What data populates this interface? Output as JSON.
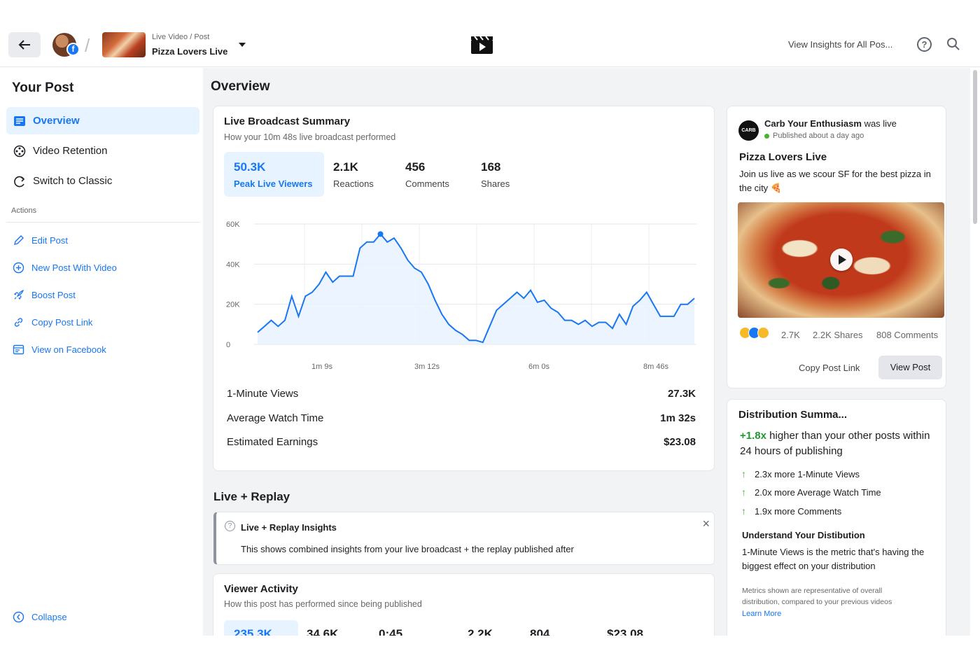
{
  "header": {
    "breadcrumb": "Live Video / Post",
    "post_title": "Pizza Lovers Live",
    "insights_link": "View Insights for All Pos...",
    "fb_badge": "f"
  },
  "sidebar": {
    "title": "Your Post",
    "nav": [
      "Overview",
      "Video Retention",
      "Switch to Classic"
    ],
    "actions_label": "Actions",
    "actions": [
      "Edit Post",
      "New Post With Video",
      "Boost Post",
      "Copy Post Link",
      "View on Facebook"
    ],
    "collapse": "Collapse"
  },
  "main": {
    "title": "Overview",
    "summary": {
      "title": "Live Broadcast Summary",
      "subtitle": "How your 10m 48s live broadcast performed",
      "metrics": [
        {
          "value": "50.3K",
          "label": "Peak Live Viewers"
        },
        {
          "value": "2.1K",
          "label": "Reactions"
        },
        {
          "value": "456",
          "label": "Comments"
        },
        {
          "value": "168",
          "label": "Shares"
        }
      ],
      "stats": [
        {
          "label": "1-Minute Views",
          "value": "27.3K"
        },
        {
          "label": "Average Watch Time",
          "value": "1m 32s"
        },
        {
          "label": "Estimated Earnings",
          "value": "$23.08"
        }
      ]
    },
    "replay": {
      "title": "Live + Replay",
      "info_title": "Live + Replay Insights",
      "info_text": "This shows combined insights from your live broadcast + the replay published after",
      "close": "×"
    },
    "activity": {
      "title": "Viewer Activity",
      "subtitle": "How this post has performed since being published",
      "values": [
        "235.3K",
        "34.6K",
        "0:45",
        "2.2K",
        "804",
        "$23.08"
      ]
    }
  },
  "post": {
    "logo": "CARB",
    "page_name": "Carb Your Enthusiasm",
    "was_live": "was live",
    "published": "Published about a day ago",
    "title": "Pizza Lovers Live",
    "description": "Join us live as we scour SF for the best pizza in the city 🍕",
    "reactions": "2.7K",
    "shares": "2.2K Shares",
    "comments": "808 Comments",
    "copy_link": "Copy Post Link",
    "view_post": "View Post"
  },
  "distribution": {
    "title": "Distribution Summa...",
    "highlight": "+1.8x",
    "headline": "higher than your other posts within 24 hours of publishing",
    "items": [
      "2.3x more 1-Minute Views",
      "2.0x more Average Watch Time",
      "1.9x more Comments"
    ],
    "understand_title": "Understand Your Distibution",
    "understand_text": "1-Minute Views is the metric that's having the biggest effect on your distribution",
    "note": "Metrics shown are representative of overall distribution, compared to your previous videos",
    "learn_more": "Learn More"
  },
  "chart_data": {
    "type": "area",
    "ylim": [
      0,
      60000
    ],
    "yticks": [
      "60K",
      "40K",
      "20K",
      "0"
    ],
    "xticks": [
      "1m 9s",
      "3m 12s",
      "6m 0s",
      "8m 46s"
    ],
    "values": [
      6000,
      9000,
      12000,
      9000,
      12000,
      24000,
      14000,
      24000,
      26000,
      30000,
      36000,
      31000,
      34000,
      34000,
      34000,
      48000,
      51000,
      51000,
      55000,
      51000,
      53000,
      48000,
      42000,
      38000,
      36000,
      30000,
      22000,
      15000,
      10000,
      7000,
      5000,
      2000,
      2000,
      1000,
      9000,
      17000,
      20000,
      23000,
      26000,
      23000,
      27000,
      21000,
      22000,
      18000,
      16000,
      12000,
      12000,
      10000,
      12000,
      9000,
      11000,
      11000,
      8000,
      15000,
      10000,
      19000,
      22000,
      26000,
      20000,
      14000,
      14000,
      14000,
      20000,
      20000,
      23000
    ],
    "peak_index": 18,
    "color": "#1877f2"
  }
}
